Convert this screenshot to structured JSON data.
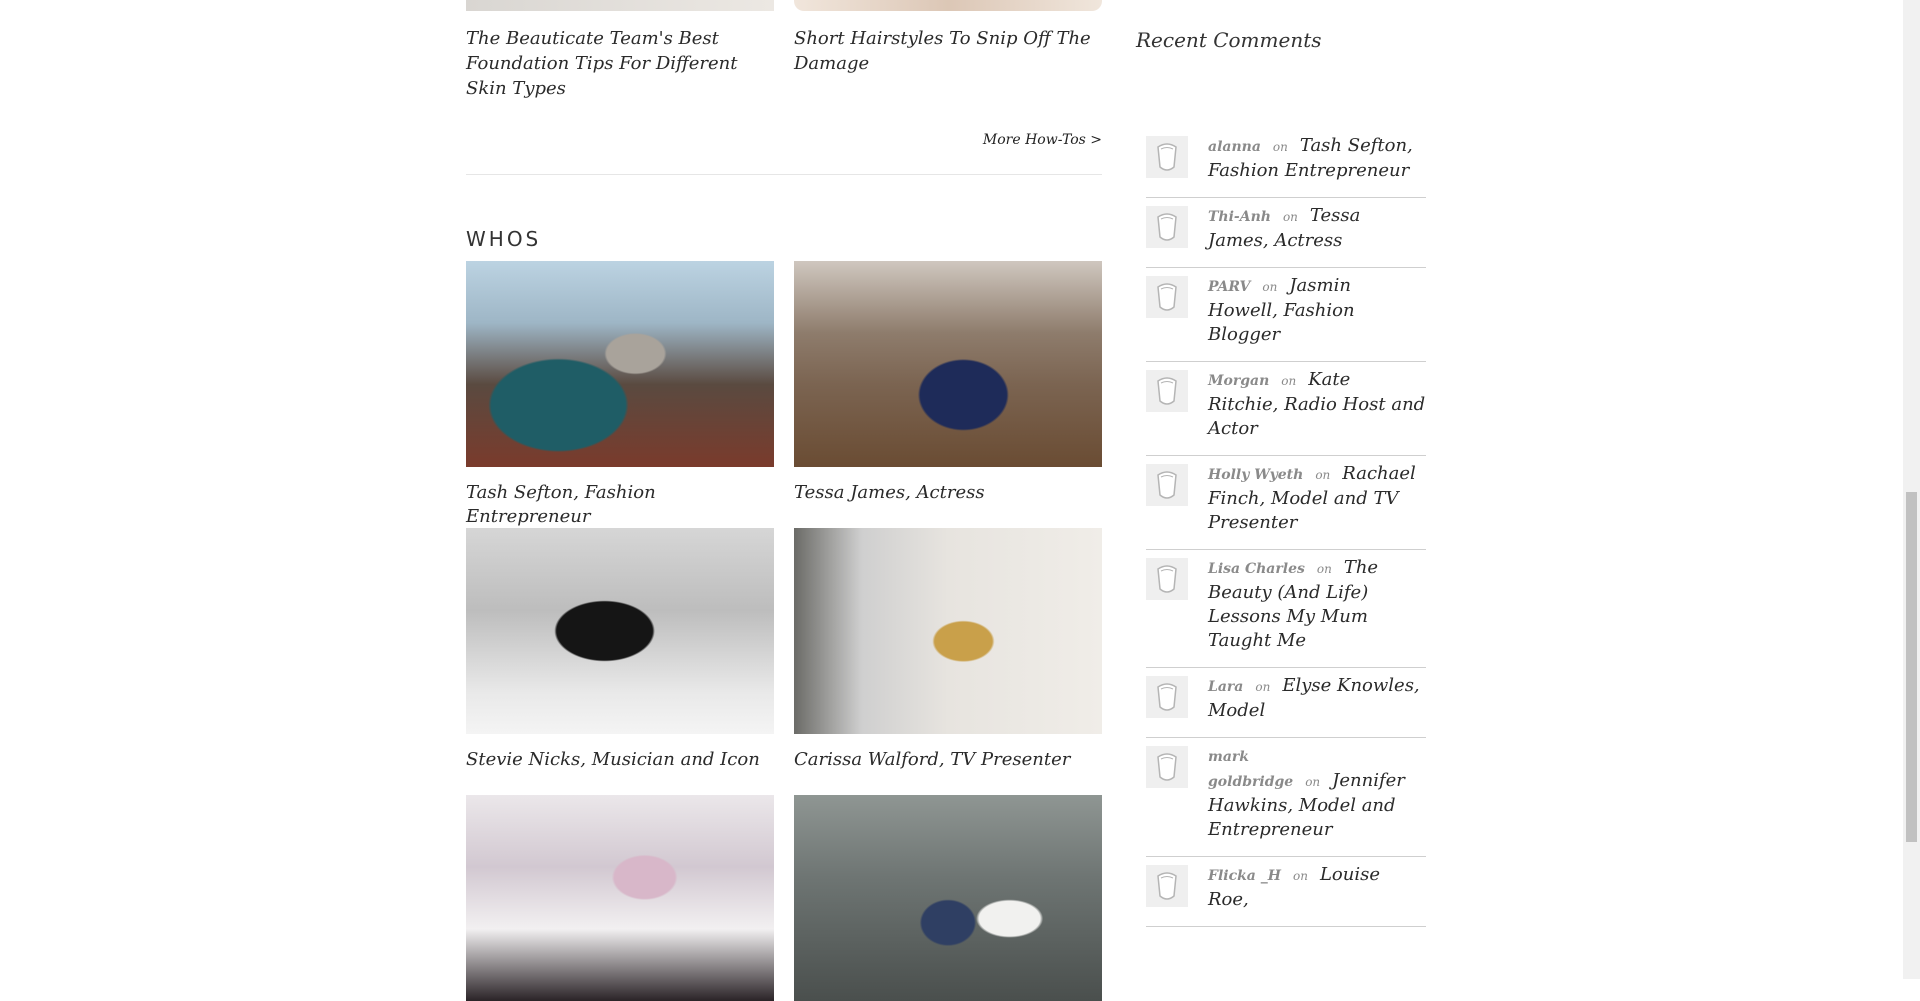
{
  "howtos": {
    "items": [
      {
        "title": "The Beauticate Team's Best Foundation Tips For Different Skin Types"
      },
      {
        "title": "Short Hairstyles To Snip Off The Damage"
      }
    ],
    "more_link": "More How-Tos >"
  },
  "whos": {
    "heading": "WHOS",
    "cards": [
      {
        "caption": "Tash Sefton, Fashion Entrepreneur"
      },
      {
        "caption": "Tessa James, Actress"
      },
      {
        "caption": "Stevie Nicks, Musician and Icon"
      },
      {
        "caption": "Carissa Walford, TV Presenter"
      },
      {
        "caption": ""
      },
      {
        "caption": ""
      }
    ]
  },
  "sidebar": {
    "title": "Recent Comments",
    "on_label": "on",
    "comments": [
      {
        "author": "alanna",
        "post": "Tash Sefton, Fashion Entrepreneur"
      },
      {
        "author": "Thi-Anh",
        "post": "Tessa James, Actress"
      },
      {
        "author": "PARV",
        "post": "Jasmin Howell, Fashion Blogger"
      },
      {
        "author": "Morgan",
        "post": "Kate Ritchie, Radio Host and Actor"
      },
      {
        "author": "Holly Wyeth",
        "post": "Rachael Finch, Model and TV Presenter"
      },
      {
        "author": "Lisa Charles",
        "post": "The Beauty (And Life) Lessons My Mum Taught Me"
      },
      {
        "author": "Lara",
        "post": "Elyse Knowles, Model"
      },
      {
        "author": "mark goldbridge",
        "post": "Jennifer Hawkins, Model and Entrepreneur"
      },
      {
        "author": "Flicka _H",
        "post": "Louise Roe,"
      }
    ]
  },
  "icons": {
    "avatar": "default-avatar-icon"
  }
}
